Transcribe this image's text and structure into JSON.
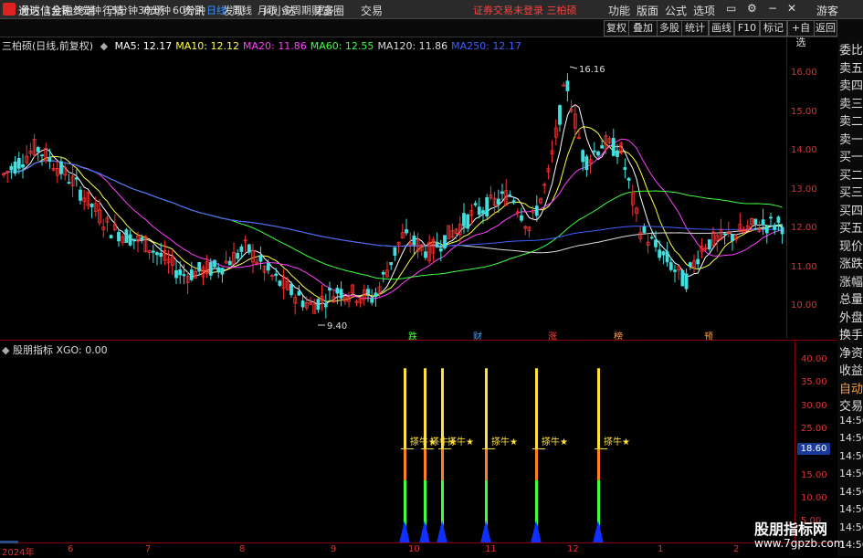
{
  "app": {
    "title": "通达信金融终端"
  },
  "menu": [
    "行情",
    "市场",
    "资讯",
    "发现",
    "问小达",
    "财富圈",
    "交易"
  ],
  "notice": "证券交易未登录 三柏硕",
  "right_menu": [
    "功能",
    "版面",
    "公式",
    "选项"
  ],
  "guest": "游客",
  "periods": [
    "分时",
    "1分钟",
    "5分钟",
    "15分钟",
    "30分钟",
    "60分钟",
    "日线",
    "周线",
    "月线",
    "多周期",
    "更多"
  ],
  "active_period": "日线",
  "tools": [
    "复权",
    "叠加",
    "多股",
    "统计",
    "画线",
    "F10",
    "标记",
    "+自选",
    "返回"
  ],
  "stock": {
    "label": "三柏硕(日线,前复权)"
  },
  "ma": [
    {
      "label": "MA5: 12.17",
      "color": "#ffffff"
    },
    {
      "label": "MA10: 12.12",
      "color": "#ffff40"
    },
    {
      "label": "MA20: 11.86",
      "color": "#ff40ff"
    },
    {
      "label": "MA60: 12.55",
      "color": "#40ff40"
    },
    {
      "label": "MA120: 11.86",
      "color": "#dddddd"
    },
    {
      "label": "MA250: 12.17",
      "color": "#4060ff"
    }
  ],
  "price_ticks": [
    "16.00",
    "15.00",
    "14.00",
    "13.00",
    "12.00",
    "11.00",
    "10.00"
  ],
  "price_high": "16.16",
  "price_low": "9.40",
  "day_markers": [
    {
      "text": "跌",
      "color": "#40ff40"
    },
    {
      "text": "财",
      "color": "#40a0ff"
    },
    {
      "text": "涨",
      "color": "#ff4040"
    },
    {
      "text": "榜",
      "color": "#ffa040"
    },
    {
      "text": "预",
      "color": "#ffa040"
    }
  ],
  "indicator": {
    "legend": "股朋指标 XGO: 0.00",
    "readout": "18.60",
    "signals": [
      "搽牛★",
      "搽牛★",
      "搽牛★",
      "搽牛★",
      "搽牛★",
      "搽牛★"
    ]
  },
  "ind_ticks": [
    "40.00",
    "35.00",
    "30.00",
    "25.00",
    "20.00",
    "15.00",
    "10.00",
    "5.00"
  ],
  "x_ticks": [
    "2024年",
    "6",
    "7",
    "8",
    "9",
    "10",
    "11",
    "12",
    "1",
    "2"
  ],
  "right_panel": [
    "委比",
    "卖五",
    "卖四",
    "卖三",
    "卖二",
    "卖一",
    "买一",
    "买二",
    "买三",
    "买四",
    "买五",
    "现价",
    "涨跌",
    "涨幅",
    "总量",
    "外盘",
    "换手",
    "净资",
    "收益",
    "自动",
    "交易",
    "14:56",
    "14:56",
    "14:56",
    "14:56",
    "14:56",
    "14:56",
    "14:56",
    "14:56"
  ],
  "watermark": {
    "cn": "股朋指标网",
    "url": "www.7gpzb.com"
  }
}
